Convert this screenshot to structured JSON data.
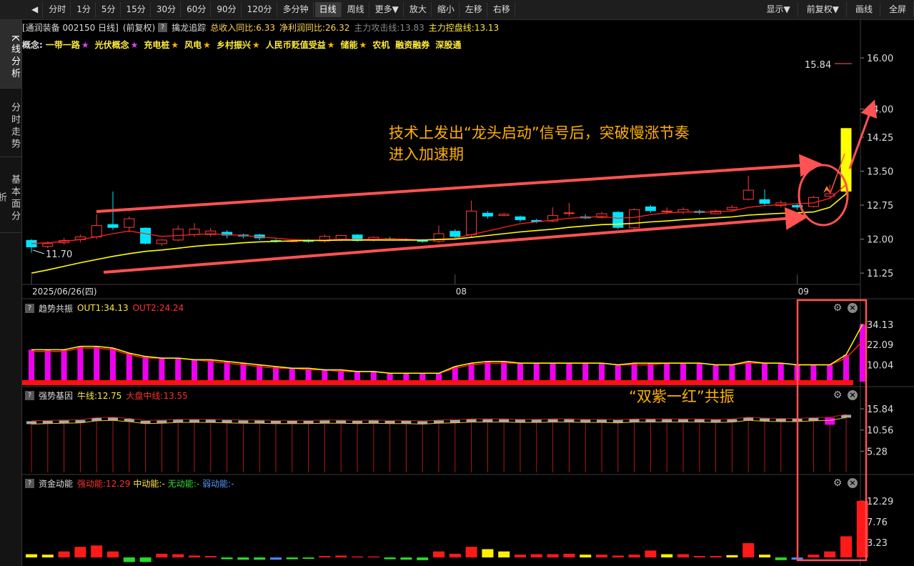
{
  "toolbar": {
    "back_label": "◀",
    "periods": [
      "分时",
      "1分",
      "5分",
      "15分",
      "30分",
      "60分",
      "90分",
      "120分",
      "多分钟",
      "日线",
      "周线",
      "更多▼",
      "放大",
      "缩小",
      "左移",
      "右移"
    ],
    "active_period": "日线",
    "right": [
      "显示▼",
      "前复权▼",
      "画线",
      "全屏"
    ]
  },
  "sidebar": [
    {
      "label": "K线分析",
      "active": true
    },
    {
      "label": "分时走势",
      "active": false
    },
    {
      "label": "基本面分析",
      "active": false
    }
  ],
  "info": {
    "stock": "[通润装备 002150 日线]",
    "adjust": "(前复权)",
    "indicator": "擒龙追踪",
    "revenue": "总收入同比:6.33",
    "profit": "净利润同比:26.32",
    "attack": "主力攻击线:13.83",
    "control": "主力控盘线:13.13"
  },
  "concepts": {
    "label": "概念:",
    "items": [
      {
        "name": "一带一路",
        "star": "★",
        "star_color": "#e040fb"
      },
      {
        "name": "光伏概念",
        "star": "★",
        "star_color": "#e040fb"
      },
      {
        "name": "充电桩",
        "star": "★",
        "star_color": "#ffb300"
      },
      {
        "name": "风电",
        "star": "★",
        "star_color": "#ffb300"
      },
      {
        "name": "乡村振兴",
        "star": "★",
        "star_color": "#ffb300"
      },
      {
        "name": "人民币贬值受益",
        "star": "★",
        "star_color": "#ffb300"
      },
      {
        "name": "储能",
        "star": "★",
        "star_color": "#ffb300"
      },
      {
        "name": "农机",
        "star": "",
        "star_color": ""
      },
      {
        "name": "融资融券",
        "star": "",
        "star_color": ""
      },
      {
        "name": "深股通",
        "star": "",
        "star_color": ""
      }
    ]
  },
  "panels": {
    "p2": {
      "name": "趋势共振",
      "out1": "OUT1:34.13",
      "out2": "OUT2:24.24"
    },
    "p3": {
      "name": "强势基因",
      "bull": "牛线:12.75",
      "mid": "大盘中线:13.55"
    },
    "p4": {
      "name": "资金动能",
      "strong": "强动能:12.29",
      "medium": "中动能:-",
      "none": "无动能:-",
      "weak": "弱动能:-"
    }
  },
  "annotations": {
    "text1": "技术上发出“龙头启动”信号后，突破慢涨节奏",
    "text2": "进入加速期",
    "text3": "“双紫一红”共振",
    "high_label": "15.84",
    "low_label": "11.70"
  },
  "colors": {
    "up": "#ff3b3b",
    "down": "#00e5ff",
    "ma_yellow": "#ffff00",
    "ma_red": "#ff2020",
    "purple": "#ee00ee",
    "annotation": "#ffb000",
    "arrow": "#ff5252"
  },
  "chart_data": [
    {
      "type": "candlestick",
      "ylim": [
        11.0,
        16.3
      ],
      "y_ticks": [
        "16.00",
        "14.00",
        "14.25",
        "13.50",
        "12.75",
        "12.00",
        "11.25"
      ],
      "x_labels": [
        "2025/06/26(四)",
        "08",
        "09"
      ],
      "x_label_index": [
        0,
        26,
        47
      ],
      "candles": [
        {
          "o": 11.98,
          "c": 11.82,
          "h": 12.0,
          "l": 11.7
        },
        {
          "o": 11.84,
          "c": 11.9,
          "h": 11.95,
          "l": 11.8
        },
        {
          "o": 11.92,
          "c": 11.97,
          "h": 12.03,
          "l": 11.88
        },
        {
          "o": 11.99,
          "c": 12.05,
          "h": 12.1,
          "l": 11.93
        },
        {
          "o": 12.05,
          "c": 12.3,
          "h": 12.55,
          "l": 12.0
        },
        {
          "o": 12.33,
          "c": 12.25,
          "h": 13.05,
          "l": 12.2
        },
        {
          "o": 12.26,
          "c": 12.45,
          "h": 12.5,
          "l": 12.15
        },
        {
          "o": 12.25,
          "c": 11.9,
          "h": 12.26,
          "l": 11.88
        },
        {
          "o": 11.9,
          "c": 11.98,
          "h": 12.0,
          "l": 11.85
        },
        {
          "o": 11.98,
          "c": 12.22,
          "h": 12.3,
          "l": 11.95
        },
        {
          "o": 12.1,
          "c": 12.22,
          "h": 12.35,
          "l": 12.05
        },
        {
          "o": 12.1,
          "c": 12.18,
          "h": 12.25,
          "l": 12.05
        },
        {
          "o": 12.16,
          "c": 12.08,
          "h": 12.2,
          "l": 12.02
        },
        {
          "o": 12.1,
          "c": 12.06,
          "h": 12.12,
          "l": 12.02
        },
        {
          "o": 12.1,
          "c": 12.02,
          "h": 12.12,
          "l": 11.98
        },
        {
          "o": 11.98,
          "c": 11.96,
          "h": 12.0,
          "l": 11.92
        },
        {
          "o": 11.96,
          "c": 11.96,
          "h": 11.99,
          "l": 11.93
        },
        {
          "o": 11.98,
          "c": 11.94,
          "h": 12.0,
          "l": 11.92
        },
        {
          "o": 11.96,
          "c": 12.06,
          "h": 12.1,
          "l": 11.92
        },
        {
          "o": 11.98,
          "c": 12.08,
          "h": 12.1,
          "l": 11.95
        },
        {
          "o": 12.1,
          "c": 11.96,
          "h": 12.11,
          "l": 11.94
        },
        {
          "o": 11.98,
          "c": 12.04,
          "h": 12.06,
          "l": 11.95
        },
        {
          "o": 12.02,
          "c": 12.0,
          "h": 12.05,
          "l": 11.97
        },
        {
          "o": 12.0,
          "c": 11.98,
          "h": 12.02,
          "l": 11.96
        },
        {
          "o": 11.98,
          "c": 11.94,
          "h": 12.0,
          "l": 11.92
        },
        {
          "o": 11.95,
          "c": 12.12,
          "h": 12.3,
          "l": 11.92
        },
        {
          "o": 12.18,
          "c": 12.05,
          "h": 12.22,
          "l": 12.0
        },
        {
          "o": 12.1,
          "c": 12.62,
          "h": 12.85,
          "l": 12.05
        },
        {
          "o": 12.58,
          "c": 12.5,
          "h": 12.62,
          "l": 12.45
        },
        {
          "o": 12.52,
          "c": 12.55,
          "h": 12.58,
          "l": 12.5
        },
        {
          "o": 12.5,
          "c": 12.42,
          "h": 12.52,
          "l": 12.38
        },
        {
          "o": 12.42,
          "c": 12.38,
          "h": 12.45,
          "l": 12.35
        },
        {
          "o": 12.4,
          "c": 12.52,
          "h": 12.7,
          "l": 12.38
        },
        {
          "o": 12.58,
          "c": 12.58,
          "h": 12.8,
          "l": 12.5
        },
        {
          "o": 12.5,
          "c": 12.46,
          "h": 12.55,
          "l": 12.44
        },
        {
          "o": 12.48,
          "c": 12.56,
          "h": 12.6,
          "l": 12.45
        },
        {
          "o": 12.6,
          "c": 12.25,
          "h": 12.62,
          "l": 12.22
        },
        {
          "o": 12.25,
          "c": 12.65,
          "h": 12.68,
          "l": 12.22
        },
        {
          "o": 12.72,
          "c": 12.62,
          "h": 12.75,
          "l": 12.58
        },
        {
          "o": 12.62,
          "c": 12.62,
          "h": 12.7,
          "l": 12.55
        },
        {
          "o": 12.6,
          "c": 12.65,
          "h": 12.7,
          "l": 12.55
        },
        {
          "o": 12.62,
          "c": 12.58,
          "h": 12.65,
          "l": 12.55
        },
        {
          "o": 12.56,
          "c": 12.62,
          "h": 12.65,
          "l": 12.55
        },
        {
          "o": 12.65,
          "c": 12.7,
          "h": 12.75,
          "l": 12.62
        },
        {
          "o": 12.88,
          "c": 13.08,
          "h": 13.4,
          "l": 12.85
        },
        {
          "o": 12.88,
          "c": 12.78,
          "h": 13.1,
          "l": 12.75
        },
        {
          "o": 12.74,
          "c": 12.8,
          "h": 12.85,
          "l": 12.7
        },
        {
          "o": 12.75,
          "c": 12.7,
          "h": 12.78,
          "l": 12.65
        },
        {
          "o": 12.72,
          "c": 12.92,
          "h": 12.96,
          "l": 12.7
        },
        {
          "o": 12.95,
          "c": 13.0,
          "h": 13.2,
          "l": 12.92
        },
        {
          "o": 13.05,
          "c": 14.45,
          "h": 14.45,
          "l": 13.0
        }
      ],
      "ma_yellow": [
        11.25,
        11.32,
        11.4,
        11.48,
        11.55,
        11.62,
        11.68,
        11.73,
        11.76,
        11.8,
        11.84,
        11.87,
        11.89,
        11.92,
        11.94,
        11.95,
        11.96,
        11.97,
        11.97,
        11.98,
        11.98,
        11.98,
        11.98,
        11.98,
        11.98,
        11.99,
        12.0,
        12.04,
        12.08,
        12.12,
        12.16,
        12.19,
        12.22,
        12.26,
        12.29,
        12.32,
        12.33,
        12.35,
        12.38,
        12.4,
        12.43,
        12.45,
        12.47,
        12.49,
        12.53,
        12.55,
        12.57,
        12.58,
        12.6,
        12.7,
        13.0
      ],
      "ma_red": [
        11.9,
        11.92,
        11.95,
        11.99,
        12.05,
        12.12,
        12.18,
        12.12,
        12.06,
        12.08,
        12.1,
        12.12,
        12.1,
        12.08,
        12.05,
        12.02,
        11.99,
        11.98,
        11.98,
        12.0,
        11.99,
        12.0,
        12.01,
        12.0,
        11.98,
        12.0,
        12.02,
        12.1,
        12.18,
        12.26,
        12.34,
        12.38,
        12.42,
        12.46,
        12.48,
        12.5,
        12.46,
        12.48,
        12.54,
        12.58,
        12.6,
        12.6,
        12.6,
        12.62,
        12.7,
        12.74,
        12.76,
        12.78,
        12.8,
        12.9,
        13.2
      ]
    },
    {
      "type": "bar",
      "name": "趋势共振",
      "ylim": [
        0,
        40
      ],
      "y_ticks": [
        "34.13",
        "22.09",
        "10.04"
      ],
      "values": [
        19,
        19,
        19,
        21,
        21,
        20,
        17,
        15,
        14,
        14,
        13,
        13,
        12,
        11,
        10,
        9,
        8,
        8,
        7,
        7,
        6,
        6,
        5,
        5,
        5,
        5,
        9,
        11,
        12,
        12,
        11,
        11,
        11,
        11,
        11,
        11,
        10,
        11,
        11,
        11,
        11,
        11,
        10,
        10,
        12,
        11,
        11,
        10,
        10,
        10,
        16,
        34
      ],
      "out2": [
        18,
        18,
        18,
        20,
        20,
        19,
        16,
        14,
        14,
        14,
        13,
        12,
        11,
        10,
        9,
        8,
        8,
        7,
        7,
        6,
        6,
        6,
        5,
        5,
        5,
        5,
        8,
        10,
        11,
        11,
        11,
        11,
        11,
        11,
        11,
        11,
        10,
        10,
        10,
        11,
        11,
        11,
        10,
        10,
        11,
        11,
        11,
        10,
        10,
        10,
        14,
        24
      ]
    },
    {
      "type": "bar",
      "name": "强势基因",
      "ylim": [
        0,
        18
      ],
      "y_ticks": [
        "15.84",
        "10.56",
        "5.28"
      ],
      "values": [
        12.4,
        12.5,
        12.6,
        12.7,
        13.2,
        13.3,
        13.0,
        12.5,
        12.6,
        12.8,
        12.8,
        12.8,
        12.7,
        12.6,
        12.6,
        12.5,
        12.5,
        12.5,
        12.6,
        12.6,
        12.5,
        12.6,
        12.5,
        12.5,
        12.4,
        12.6,
        12.7,
        12.9,
        12.9,
        12.9,
        12.8,
        12.8,
        12.9,
        12.9,
        12.8,
        12.8,
        12.7,
        12.9,
        12.9,
        12.9,
        12.9,
        12.9,
        12.8,
        12.9,
        13.3,
        13.1,
        13.0,
        13.0,
        13.2,
        13.3,
        14.0
      ]
    },
    {
      "type": "bar",
      "name": "资金动能",
      "ylim": [
        0,
        14
      ],
      "y_ticks": [
        "12.29",
        "7.76",
        "3.23"
      ],
      "values": [
        0.7,
        0.6,
        1.3,
        2.3,
        2.6,
        1.3,
        -1.0,
        -1.0,
        0.8,
        0.7,
        0.4,
        0.3,
        -0.4,
        -0.5,
        -0.5,
        -0.5,
        -0.4,
        -0.3,
        0.3,
        0.4,
        0.2,
        0.2,
        -0.4,
        -0.5,
        -0.6,
        1.3,
        0.8,
        2.3,
        1.8,
        1.3,
        0.6,
        0.7,
        0.7,
        0.8,
        0.6,
        0.6,
        0.4,
        0.6,
        1.5,
        0.7,
        0.7,
        0.3,
        0.3,
        0.5,
        3.1,
        0.6,
        -0.6,
        -0.5,
        0.6,
        1.3,
        4.6,
        12.3
      ],
      "value_kind": [
        "y",
        "y",
        "r",
        "r",
        "r",
        "r",
        "g",
        "g",
        "r",
        "r",
        "r",
        "r",
        "g",
        "g",
        "g",
        "b",
        "g",
        "g",
        "r",
        "r",
        "r",
        "r",
        "g",
        "g",
        "g",
        "r",
        "r",
        "r",
        "y",
        "y",
        "r",
        "r",
        "r",
        "r",
        "y",
        "r",
        "r",
        "r",
        "r",
        "y",
        "r",
        "r",
        "r",
        "y",
        "r",
        "y",
        "g",
        "b",
        "r",
        "r",
        "r",
        "r"
      ]
    }
  ]
}
